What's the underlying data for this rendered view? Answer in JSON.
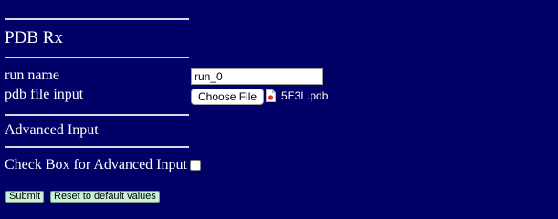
{
  "header": {
    "title": "PDB Rx"
  },
  "form": {
    "run_name": {
      "label": "run name",
      "value": "run_0"
    },
    "pdb_file": {
      "label": "pdb file input",
      "button_label": "Choose File",
      "file_name": "5E3L.pdb"
    },
    "advanced": {
      "heading": "Advanced Input",
      "checkbox_label": "Check Box for Advanced Input",
      "checked": false
    },
    "actions": {
      "submit_label": "Submit",
      "reset_label": "Reset to default values"
    }
  },
  "colors": {
    "background": "#000066",
    "text": "#ffffff",
    "action_button": "#c8f0d8"
  }
}
